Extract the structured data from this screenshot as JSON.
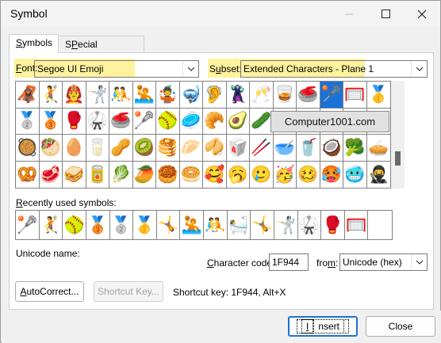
{
  "window": {
    "title": "Symbol"
  },
  "tabs": [
    {
      "label": "Symbols",
      "access_key": "S",
      "rest": "ymbols"
    },
    {
      "label": "Special Characters",
      "access_key": "P",
      "before": "S",
      "rest": "ecial Characters"
    }
  ],
  "font": {
    "label_key": "F",
    "label_rest": "ont:",
    "value": "Segoe UI Emoji"
  },
  "subset": {
    "label_before": "S",
    "label_key": "u",
    "label_rest": "bset:",
    "value": "Extended Characters - Plane 1"
  },
  "symbol_grid": {
    "rows": [
      [
        "🦧",
        "🤾",
        "🧑‍🚒",
        "🤺",
        "🤼",
        "🤽",
        "🤹",
        "🤿",
        "🦻",
        "🦹",
        "🥂",
        "🥃",
        "🥌",
        "🥍",
        "🥅",
        "🥇"
      ],
      [
        "🥈",
        "🥉",
        "🥊",
        "🥋",
        "🥌",
        "🥍",
        "🥎",
        "🥏",
        "🥐",
        "🥑",
        "🥒",
        "🥓",
        "🥔",
        "🥕",
        "🥖",
        "🥗"
      ],
      [
        "🥘",
        "🥙",
        "🥚",
        "🥛",
        "🥜",
        "🥝",
        "🥞",
        "🥟",
        "🥠",
        "🥡",
        "🥢",
        "🥣",
        "🥤",
        "🥥",
        "🥦",
        "🥧"
      ],
      [
        "🥨",
        "🥩",
        "🥪",
        "🥫",
        "🥬",
        "🥭",
        "🥮",
        "🥯",
        "🥰",
        "🥱",
        "🥲",
        "🥳",
        "🥴",
        "🥵",
        "🥶",
        "🥷"
      ]
    ],
    "selected": {
      "row": 0,
      "col": 13
    }
  },
  "tooltip": {
    "text": "Computer1001.com"
  },
  "recent": {
    "label_key": "R",
    "label_rest": "ecently used symbols:",
    "symbols": [
      "🥍",
      "🤾",
      "🥎",
      "🥉",
      "🥈",
      "🥇",
      "🤸",
      "🤽",
      "🤼",
      "🛀",
      "🤸",
      "🤺",
      "🥋",
      "🥊",
      "🥅",
      ""
    ]
  },
  "unicode_name": {
    "label": "Unicode name:"
  },
  "character_code": {
    "label_key": "C",
    "label_rest": "haracter code:",
    "value": "1F944"
  },
  "from": {
    "label_before": "fro",
    "label_key": "m",
    "label_rest": ":",
    "value": "Unicode (hex)"
  },
  "buttons": {
    "autocorrect": {
      "key": "A",
      "rest": "utoCorrect..."
    },
    "shortcut_key": {
      "label": "Shortcut Key..."
    },
    "insert": {
      "key": "I",
      "rest": "nsert"
    },
    "close": {
      "label": "Close"
    }
  },
  "shortcut_info": {
    "text": "Shortcut key: 1F944, Alt+X"
  }
}
